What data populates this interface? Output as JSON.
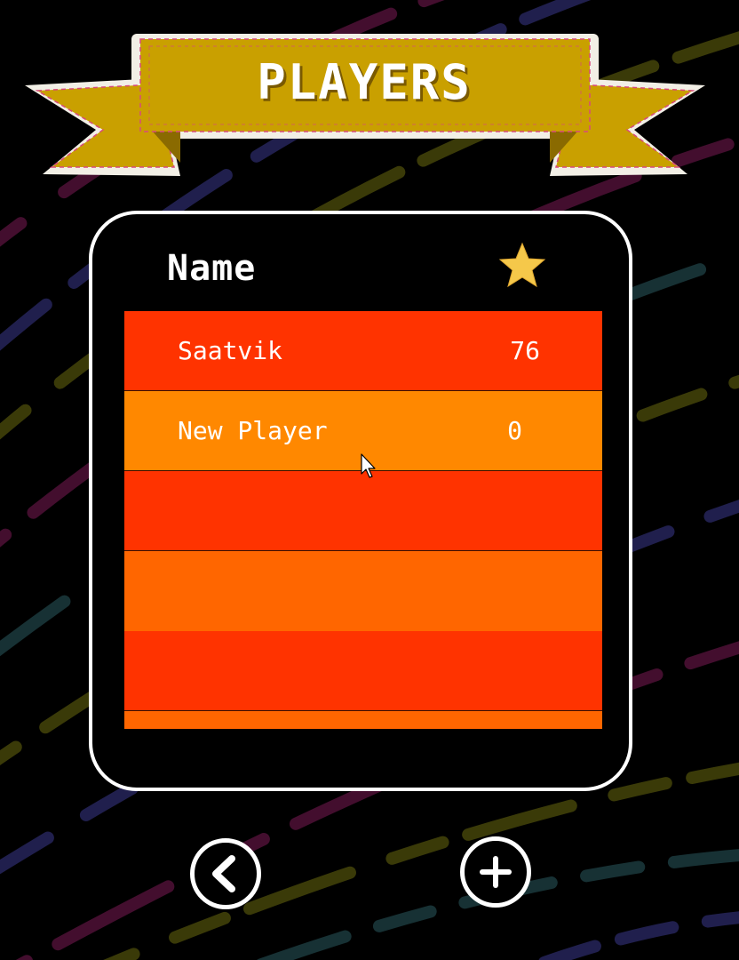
{
  "banner": {
    "title": "PLAYERS"
  },
  "table": {
    "name_header": "Name",
    "score_header_icon": "star-icon",
    "rows": [
      {
        "name": "Saatvik",
        "score": "76",
        "color": "#ff3300"
      },
      {
        "name": "New Player",
        "score": "0",
        "color": "#ff8800"
      },
      {
        "name": "",
        "score": "",
        "color": "#ff3300"
      },
      {
        "name": "",
        "score": "",
        "color": "#ff6600"
      },
      {
        "name": "",
        "score": "",
        "color": "#ff3300"
      },
      {
        "name": "",
        "score": "",
        "color": "#ff6600"
      }
    ]
  },
  "controls": {
    "back_icon": "chevron-left-icon",
    "add_icon": "plus-icon"
  },
  "colors": {
    "banner_gold": "#c9a000",
    "panel_border": "#ffffff",
    "star": "#f5c84a",
    "row_red": "#ff3300",
    "row_orange": "#ff8800"
  }
}
